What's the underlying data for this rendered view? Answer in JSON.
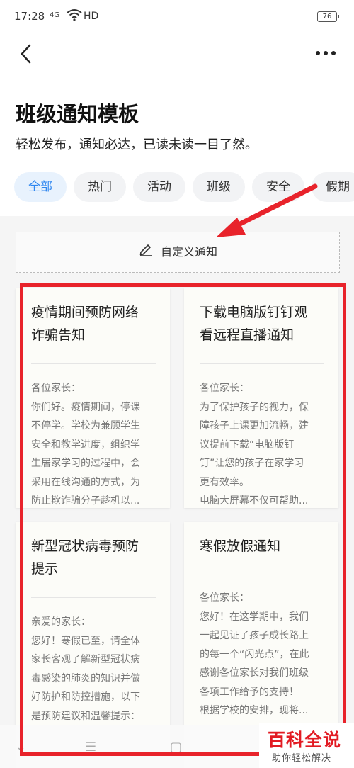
{
  "status": {
    "time": "17:28",
    "network": "4G",
    "hd": "HD",
    "battery": "76"
  },
  "header": {
    "title": "班级通知模板",
    "subtitle": "轻松发布，通知必达，已读未读一目了然。"
  },
  "tabs": [
    {
      "label": "全部"
    },
    {
      "label": "热门"
    },
    {
      "label": "活动"
    },
    {
      "label": "班级"
    },
    {
      "label": "安全"
    },
    {
      "label": "假期"
    }
  ],
  "custom_button": {
    "label": "自定义通知"
  },
  "cards": [
    {
      "title_lines": [
        "疫情期间预防网络",
        "诈骗告知"
      ],
      "body_lines": [
        "各位家长：",
        "你们好。疫情期间，停课",
        "不停学。学校为兼顾学生",
        "安全和教学进度，组织学",
        "生居家学习的过程中，会",
        "采用在线沟通的方式，为",
        "防止欺诈骗分子趁机以..."
      ]
    },
    {
      "title_lines": [
        "下载电脑版钉钉观",
        "看远程直播通知"
      ],
      "body_lines": [
        "各位家长：",
        "为了保护孩子的视力，保",
        "障孩子上课更加流畅，建",
        "议提前下载“电脑版钉",
        "钉”让您的孩子在家学习",
        "更有效率。",
        "电脑大屏幕不仅可帮助..."
      ]
    },
    {
      "title_lines": [
        "新型冠状病毒预防",
        "提示"
      ],
      "body_lines": [
        "亲爱的家长：",
        "您好！寒假已至，请全体",
        "家长客观了解新型冠状病",
        "毒感染的肺炎的知识并做",
        "好防护和防控措施，以下",
        "是预防建议和温馨提示："
      ]
    },
    {
      "title_lines": [
        "寒假放假通知"
      ],
      "body_lines": [
        "各位家长：",
        "您好！在这学期中，我们",
        "一起见证了孩子成长路上",
        "的每一个“闪光点”，在此",
        "感谢各位家长对我们班级",
        "各项工作给予的支持！",
        "根据学校的安排，现将..."
      ]
    }
  ],
  "watermark": {
    "main": "百科全说",
    "sub": "助你轻松解决"
  },
  "colors": {
    "accent": "#2f87f0",
    "annotation_red": "#e8232b"
  }
}
